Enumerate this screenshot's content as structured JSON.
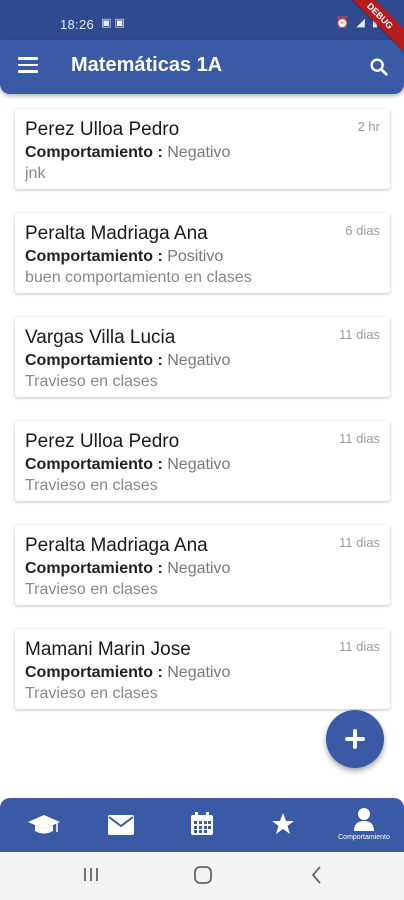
{
  "status_bar": {
    "time": "18:26",
    "debug_label": "DEBUG"
  },
  "app_bar": {
    "title": "Matemáticas 1A",
    "menu_icon": "menu-icon",
    "search_icon": "search-icon"
  },
  "records": [
    {
      "name": "Perez Ulloa Pedro",
      "time_ago": "2 hr",
      "behavior_label": "Comportamiento :",
      "behavior_value": "Negativo",
      "description": "jnk"
    },
    {
      "name": "Peralta Madriaga Ana",
      "time_ago": "6 dias",
      "behavior_label": "Comportamiento :",
      "behavior_value": "Positivo",
      "description": "buen comportamiento en clases"
    },
    {
      "name": "Vargas Villa Lucia",
      "time_ago": "11 dias",
      "behavior_label": "Comportamiento :",
      "behavior_value": "Negativo",
      "description": "Travieso en clases"
    },
    {
      "name": "Perez Ulloa Pedro",
      "time_ago": "11 dias",
      "behavior_label": "Comportamiento :",
      "behavior_value": "Negativo",
      "description": "Travieso en clases"
    },
    {
      "name": "Peralta Madriaga Ana",
      "time_ago": "11 dias",
      "behavior_label": "Comportamiento :",
      "behavior_value": "Negativo",
      "description": "Travieso en clases"
    },
    {
      "name": "Mamani Marin Jose",
      "time_ago": "11 dias",
      "behavior_label": "Comportamiento :",
      "behavior_value": "Negativo",
      "description": "Travieso en clases"
    }
  ],
  "fab": {
    "icon": "add-icon"
  },
  "bottom_nav": {
    "items": [
      {
        "icon": "graduation-cap-icon"
      },
      {
        "icon": "envelope-icon"
      },
      {
        "icon": "calendar-icon"
      },
      {
        "icon": "star-icon"
      },
      {
        "icon": "user-icon",
        "label": "Comportamiento"
      }
    ]
  },
  "colors": {
    "primary": "#3b5aa6",
    "status_bar": "#2f4a8f",
    "debug": "#b71c1c"
  }
}
